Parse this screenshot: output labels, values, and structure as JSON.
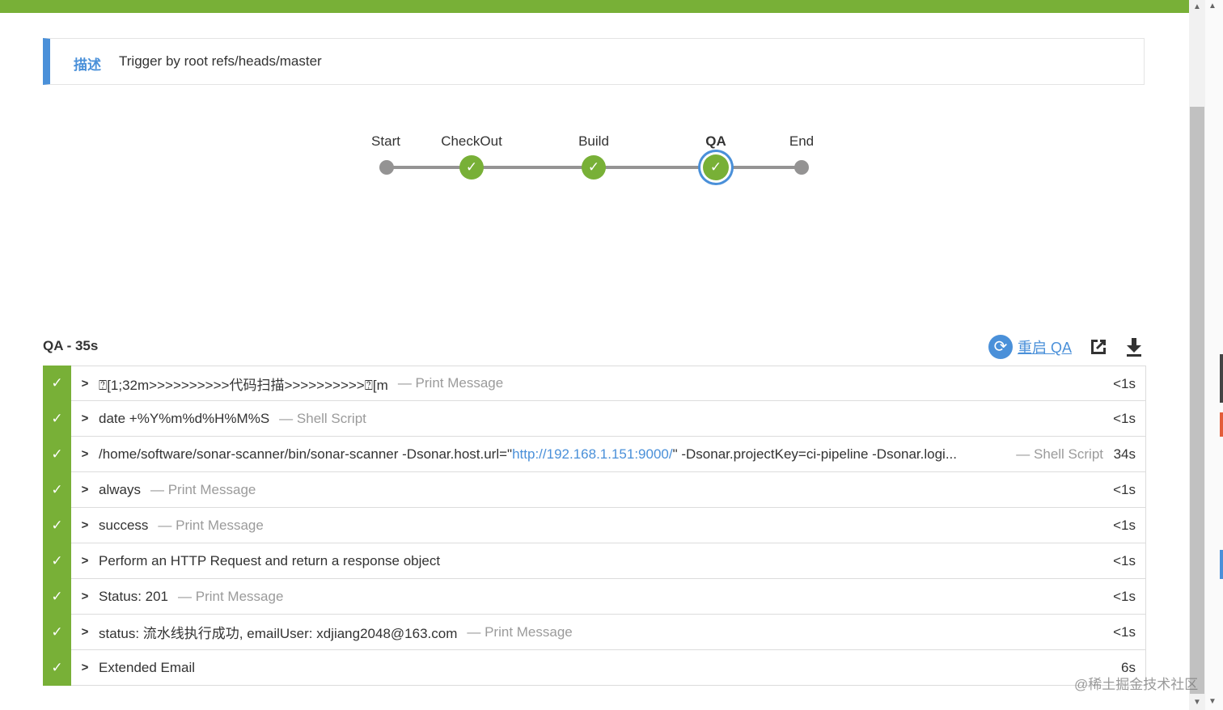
{
  "description": {
    "label": "描述",
    "text": "Trigger by root refs/heads/master"
  },
  "pipeline": {
    "stages": [
      {
        "name": "Start",
        "status": "none"
      },
      {
        "name": "CheckOut",
        "status": "success"
      },
      {
        "name": "Build",
        "status": "success"
      },
      {
        "name": "QA",
        "status": "success",
        "selected": true
      },
      {
        "name": "End",
        "status": "none"
      }
    ]
  },
  "step_header": {
    "title": "QA - 35s",
    "restart_label": "重启 QA"
  },
  "steps": [
    {
      "text": "\u001b[1;32m>>>>>>>>>>代码扫描>>>>>>>>>>\u001b[m",
      "display_text": "⍰[1;32m>>>>>>>>>>代码扫描>>>>>>>>>>⍰[m",
      "type": "— Print Message",
      "duration": "<1s"
    },
    {
      "text": "date +%Y%m%d%H%M%S",
      "type": "— Shell Script",
      "duration": "<1s"
    },
    {
      "text_prefix": "/home/software/sonar-scanner/bin/sonar-scanner -Dsonar.host.url=\"",
      "url": "http://192.168.1.151:9000/",
      "text_suffix": "\" -Dsonar.projectKey=ci-pipeline -Dsonar.logi...",
      "type": "— Shell Script",
      "duration": "34s"
    },
    {
      "text": "always",
      "type": "— Print Message",
      "duration": "<1s"
    },
    {
      "text": "success",
      "type": "— Print Message",
      "duration": "<1s"
    },
    {
      "text": "Perform an HTTP Request and return a response object",
      "type": "",
      "duration": "<1s"
    },
    {
      "text": "Status: 201",
      "type": "— Print Message",
      "duration": "<1s"
    },
    {
      "text": "status: 流水线执行成功, emailUser: xdjiang2048@163.com",
      "type": "— Print Message",
      "duration": "<1s"
    },
    {
      "text": "Extended Email",
      "type": "",
      "duration": "6s"
    }
  ],
  "watermark": "@稀土掘金技术社区",
  "colors": {
    "success": "#78b037",
    "accent": "#4a90d9",
    "connector": "#949393"
  },
  "icons": {
    "check": "check-icon",
    "chevron": "chevron-right-icon",
    "restart": "restart-icon",
    "open": "open-external-icon",
    "download": "download-icon"
  }
}
